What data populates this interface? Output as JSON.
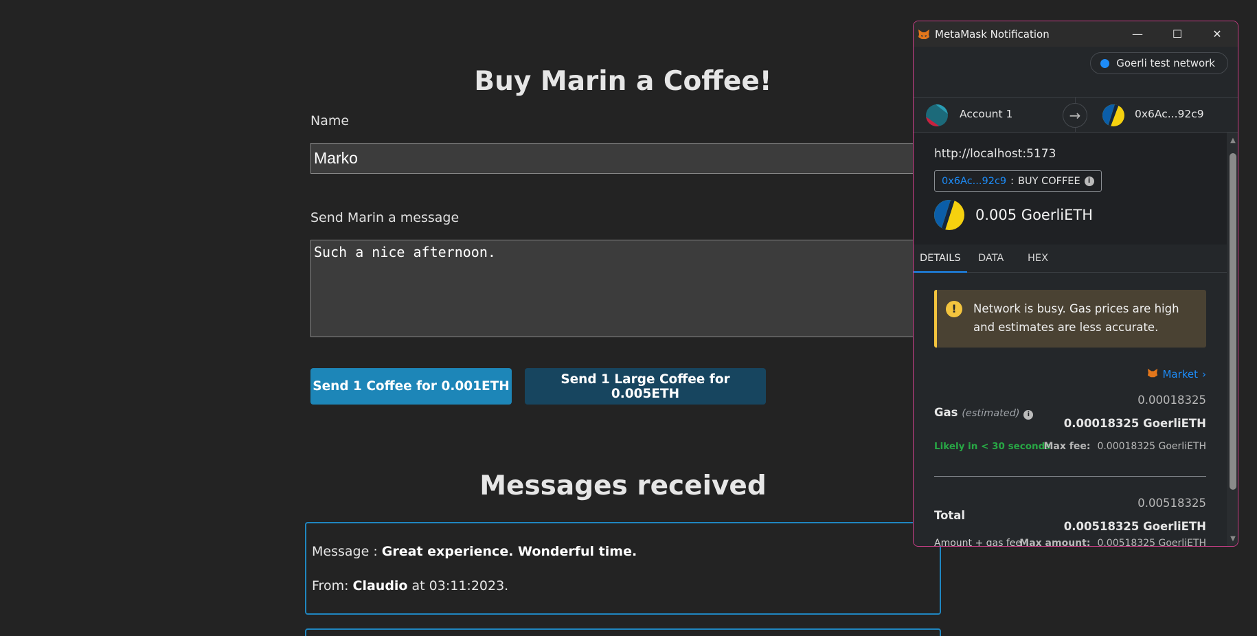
{
  "app": {
    "title": "Buy Marin a Coffee!",
    "name_label": "Name",
    "name_value": "Marko",
    "message_label": "Send Marin a message",
    "message_value": "Such a nice afternoon.",
    "btn_small": "Send 1 Coffee for 0.001ETH",
    "btn_large": "Send 1 Large Coffee for 0.005ETH",
    "messages_title": "Messages received",
    "messages": [
      {
        "message_prefix": "Message : ",
        "message": "Great experience. Wonderful time.",
        "from_prefix": "From: ",
        "from": "Claudio",
        "at": " at 03:11:2023."
      }
    ]
  },
  "metamask": {
    "window_title": "MetaMask Notification",
    "window_controls": {
      "minimize": "—",
      "maximize": "☐",
      "close": "✕"
    },
    "network": "Goerli test network",
    "from_account": "Account 1",
    "to_account": "0x6Ac...92c9",
    "origin": "http://localhost:5173",
    "method_address": "0x6Ac...92c9",
    "method_sep": ":",
    "method_name": "BUY COFFEE",
    "amount": "0.005 GoerliETH",
    "tabs": [
      "DETAILS",
      "DATA",
      "HEX"
    ],
    "active_tab": "DETAILS",
    "warning": "Network is busy. Gas prices are high and estimates are less accurate.",
    "market_label": "Market",
    "gas_label": "Gas",
    "gas_estimated": "(estimated)",
    "gas_value": "0.00018325",
    "gas_value_bold": "0.00018325 GoerliETH",
    "likely": "Likely in < 30 seconds",
    "max_fee_label": "Max fee:",
    "max_fee_value": "0.00018325 GoerliETH",
    "total_label": "Total",
    "total_value": "0.00518325",
    "total_value_bold": "0.00518325 GoerliETH",
    "amount_gas_label": "Amount + gas fee",
    "max_amount_label": "Max amount:",
    "max_amount_value": "0.00518325 GoerliETH",
    "colors": {
      "accent": "#1d8cf8",
      "warning": "#f3c43e",
      "success": "#28a745",
      "border": "#c73e86"
    }
  }
}
